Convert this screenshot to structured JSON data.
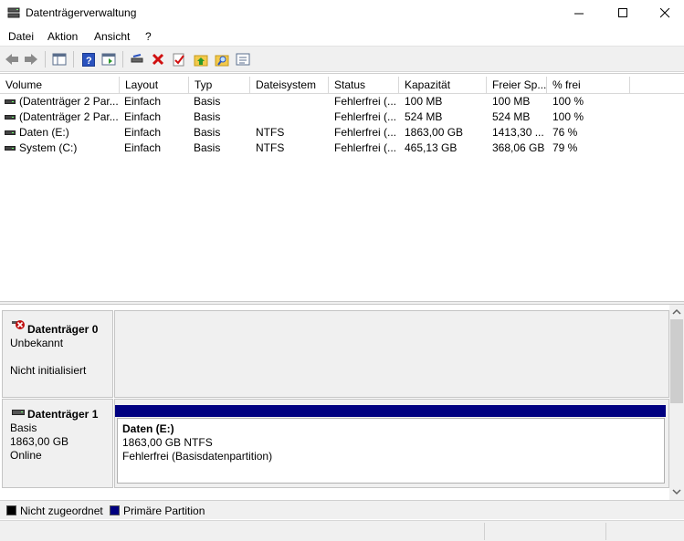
{
  "window": {
    "title": "Datenträgerverwaltung",
    "icon": "disk-management-icon"
  },
  "menu": {
    "items": [
      "Datei",
      "Aktion",
      "Ansicht",
      "?"
    ]
  },
  "toolbar": {
    "buttons": [
      "back-icon",
      "forward-icon",
      "console-tree-icon",
      "help-icon",
      "properties-view-icon",
      "connect-disk-icon",
      "delete-icon",
      "check-icon",
      "up-folder-icon",
      "search-folder-icon",
      "properties-icon"
    ]
  },
  "volume_list": {
    "columns": [
      "Volume",
      "Layout",
      "Typ",
      "Dateisystem",
      "Status",
      "Kapazität",
      "Freier Sp...",
      "% frei"
    ],
    "rows": [
      [
        "(Datenträger 2 Par...",
        "Einfach",
        "Basis",
        "",
        "Fehlerfrei (...",
        "100 MB",
        "100 MB",
        "100 %"
      ],
      [
        "(Datenträger 2 Par...",
        "Einfach",
        "Basis",
        "",
        "Fehlerfrei (...",
        "524 MB",
        "524 MB",
        "100 %"
      ],
      [
        "Daten (E:)",
        "Einfach",
        "Basis",
        "NTFS",
        "Fehlerfrei (...",
        "1863,00 GB",
        "1413,30 ...",
        "76 %"
      ],
      [
        "System (C:)",
        "Einfach",
        "Basis",
        "NTFS",
        "Fehlerfrei (...",
        "465,13 GB",
        "368,06 GB",
        "79 %"
      ]
    ]
  },
  "disks": {
    "disk0": {
      "name": "Datenträger 0",
      "line1": "Unbekannt",
      "line2": "Nicht initialisiert"
    },
    "disk1": {
      "name": "Datenträger 1",
      "line1": "Basis",
      "line2": "1863,00 GB",
      "line3": "Online",
      "partition": {
        "title": "Daten  (E:)",
        "size": "1863,00 GB NTFS",
        "status": "Fehlerfrei (Basisdatenpartition)"
      }
    }
  },
  "legend": {
    "unallocated": {
      "label": "Nicht zugeordnet",
      "color": "#000000"
    },
    "primary": {
      "label": "Primäre Partition",
      "color": "#000080"
    }
  }
}
